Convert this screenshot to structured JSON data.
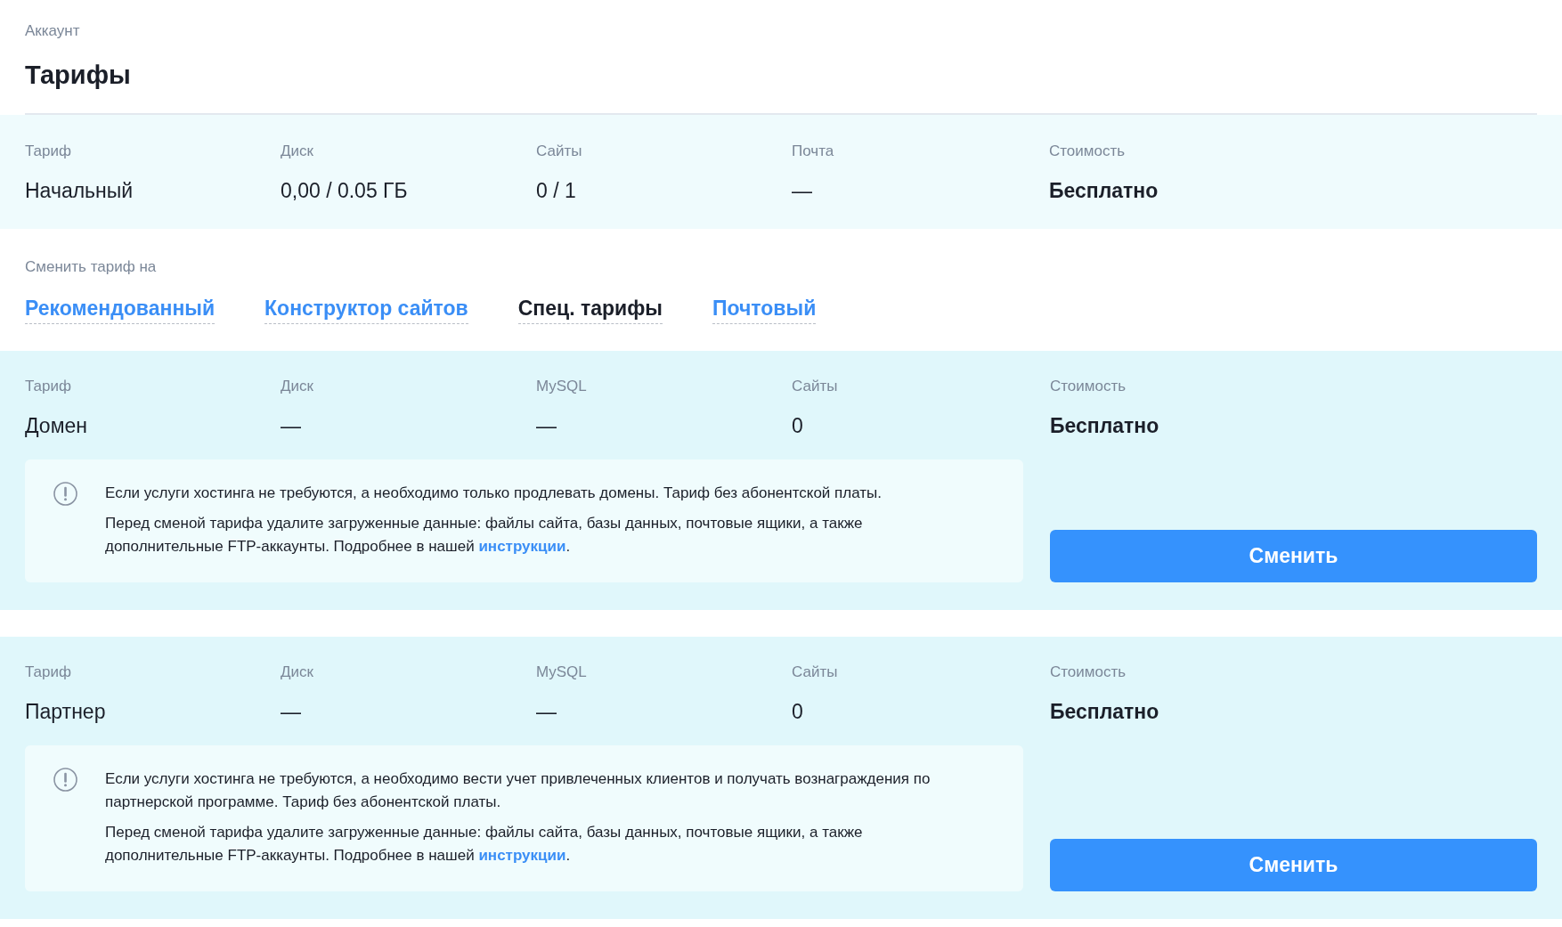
{
  "breadcrumb": "Аккаунт",
  "title": "Тарифы",
  "current_plan": {
    "columns": [
      {
        "label": "Тариф",
        "value": "Начальный"
      },
      {
        "label": "Диск",
        "value": "0,00 / 0.05 ГБ"
      },
      {
        "label": "Сайты",
        "value": "0 / 1"
      },
      {
        "label": "Почта",
        "value": "—"
      }
    ],
    "cost": {
      "label": "Стоимость",
      "value": "Бесплатно"
    }
  },
  "change_to": {
    "label": "Сменить тариф на",
    "tabs": [
      {
        "label": "Рекомендованный",
        "selected": false
      },
      {
        "label": "Конструктор сайтов",
        "selected": false
      },
      {
        "label": "Спец. тарифы",
        "selected": true
      },
      {
        "label": "Почтовый",
        "selected": false
      }
    ]
  },
  "plans": [
    {
      "columns": [
        {
          "label": "Тариф",
          "value": "Домен"
        },
        {
          "label": "Диск",
          "value": "—"
        },
        {
          "label": "MySQL",
          "value": "—"
        },
        {
          "label": "Сайты",
          "value": "0"
        }
      ],
      "cost": {
        "label": "Стоимость",
        "value": "Бесплатно"
      },
      "info": [
        {
          "text": "Если услуги хостинга не требуются, а необходимо только продлевать домены. Тариф без абонентской платы."
        },
        {
          "text": "Перед сменой тарифа удалите загруженные данные: файлы сайта, базы данных, почтовые ящики, а также дополнительные FTP-аккаунты. Подробнее в нашей",
          "link": "инструкции",
          "tail": "."
        }
      ],
      "button": "Сменить"
    },
    {
      "columns": [
        {
          "label": "Тариф",
          "value": "Партнер"
        },
        {
          "label": "Диск",
          "value": "—"
        },
        {
          "label": "MySQL",
          "value": "—"
        },
        {
          "label": "Сайты",
          "value": "0"
        }
      ],
      "cost": {
        "label": "Стоимость",
        "value": "Бесплатно"
      },
      "info": [
        {
          "text": "Если услуги хостинга не требуются, а необходимо вести учет привлеченных клиентов и получать вознаграждения по партнерской программе. Тариф без абонентской платы."
        },
        {
          "text": "Перед сменой тарифа удалите загруженные данные: файлы сайта, базы данных, почтовые ящики, а также дополнительные FTP-аккаунты. Подробнее в нашей",
          "link": "инструкции",
          "tail": "."
        }
      ],
      "button": "Сменить"
    }
  ]
}
